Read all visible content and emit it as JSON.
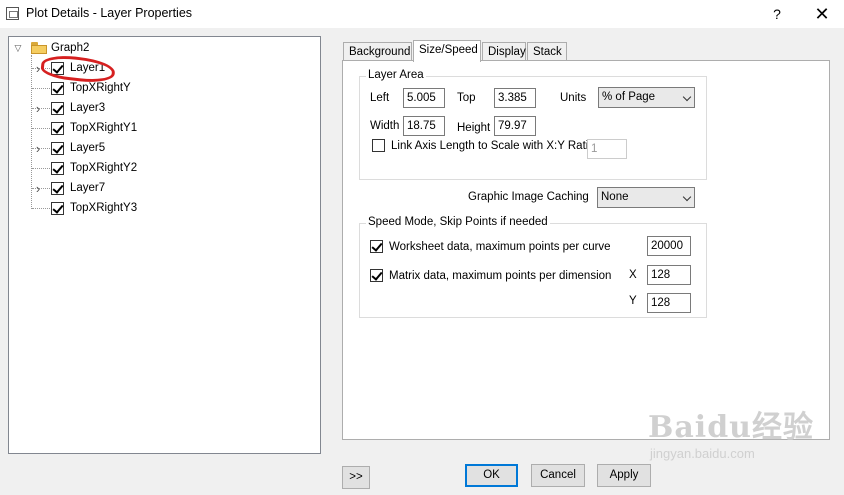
{
  "window": {
    "title": "Plot Details - Layer Properties",
    "help_label": "?",
    "close_label": "✕"
  },
  "tree": {
    "root": {
      "label": "Graph2",
      "icon": "folder-icon"
    },
    "items": [
      {
        "label": "Layer1",
        "checked": true,
        "expandable": true
      },
      {
        "label": "TopXRightY",
        "checked": true,
        "expandable": false
      },
      {
        "label": "Layer3",
        "checked": true,
        "expandable": true
      },
      {
        "label": "TopXRightY1",
        "checked": true,
        "expandable": false
      },
      {
        "label": "Layer5",
        "checked": true,
        "expandable": true
      },
      {
        "label": "TopXRightY2",
        "checked": true,
        "expandable": false
      },
      {
        "label": "Layer7",
        "checked": true,
        "expandable": true
      },
      {
        "label": "TopXRightY3",
        "checked": true,
        "expandable": false
      }
    ],
    "highlight_color": "#d62020"
  },
  "tabs": [
    {
      "label": "Background",
      "active": false
    },
    {
      "label": "Size/Speed",
      "active": true
    },
    {
      "label": "Display",
      "active": false
    },
    {
      "label": "Stack",
      "active": false
    }
  ],
  "layer_area": {
    "title": "Layer Area",
    "left_label": "Left",
    "left_value": "5.005",
    "top_label": "Top",
    "top_value": "3.385",
    "units_label": "Units",
    "units_value": "% of Page",
    "width_label": "Width",
    "width_value": "18.75",
    "height_label": "Height",
    "height_value": "79.97",
    "link_label": "Link Axis Length to Scale with X:Y Ratio",
    "link_checked": false,
    "ratio_value": "1"
  },
  "caching": {
    "label": "Graphic Image Caching",
    "value": "None"
  },
  "speed_mode": {
    "title": "Speed Mode, Skip Points if needed",
    "worksheet_label": "Worksheet data, maximum points per curve",
    "worksheet_checked": true,
    "worksheet_value": "20000",
    "matrix_label": "Matrix data, maximum points per dimension",
    "matrix_checked": true,
    "x_label": "X",
    "x_value": "128",
    "y_label": "Y",
    "y_value": "128"
  },
  "buttons": {
    "more": ">>",
    "ok": "OK",
    "cancel": "Cancel",
    "apply": "Apply"
  },
  "watermark": {
    "big": "Baidu经验",
    "small": "jingyan.baidu.com"
  }
}
